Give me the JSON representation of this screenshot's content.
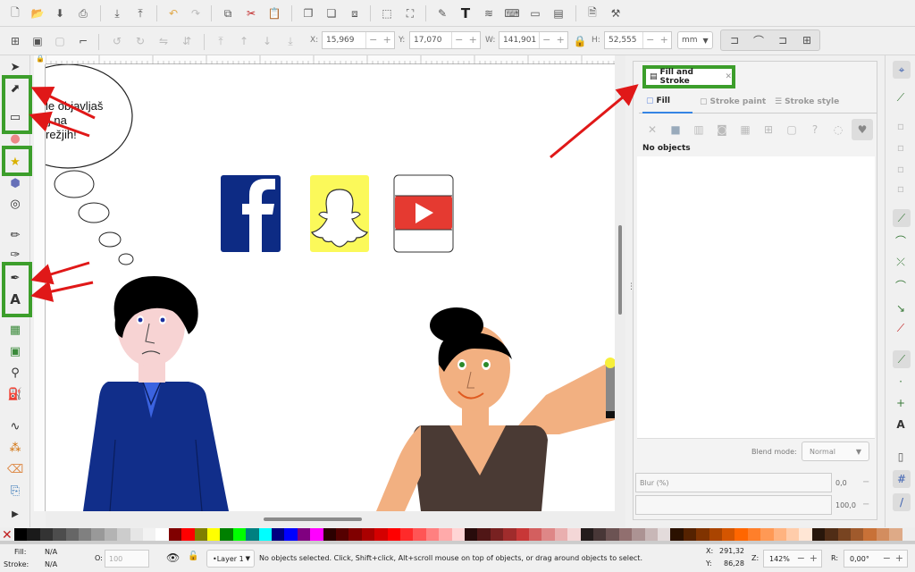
{
  "toolbar_top": {
    "icons": [
      "new-document-icon",
      "open-icon",
      "save-icon",
      "print-icon",
      "import-icon",
      "export-icon",
      "undo-icon",
      "redo-icon",
      "copy-icon",
      "cut-icon",
      "paste-icon",
      "duplicate-icon",
      "clone-icon",
      "unlink-clone-icon",
      "zoom-selection-icon",
      "zoom-drawing-icon",
      "pen-edit-icon",
      "text-icon",
      "layers-icon",
      "xml-editor-icon",
      "align-icon",
      "fill-stroke-icon",
      "document-properties-icon",
      "preferences-icon"
    ]
  },
  "toolbar_select": {
    "x_label": "X:",
    "x_value": "15,969",
    "y_label": "Y:",
    "y_value": "17,070",
    "w_label": "W:",
    "w_value": "141,901",
    "h_label": "H:",
    "h_value": "52,555",
    "units": "mm"
  },
  "speech_bubble": {
    "line1": "e",
    "line2": "le objavljaš",
    "line3": "ij na",
    "line4": "režjih!"
  },
  "panel": {
    "tab_title": "Fill and Stroke",
    "tabs": [
      "Fill",
      "Stroke paint",
      "Stroke style"
    ],
    "no_objects": "No objects",
    "blend_label": "Blend mode:",
    "blend_value": "Normal",
    "blur_label": "Blur (%)",
    "blur_value": "0,0",
    "opacity_value": "100,0"
  },
  "status": {
    "fill_label": "Fill:",
    "fill_value": "N/A",
    "stroke_label": "Stroke:",
    "stroke_value": "N/A",
    "o_label": "O:",
    "o_value": "100",
    "layer": "•Layer 1",
    "message": "No objects selected. Click, Shift+click, Alt+scroll mouse on top of objects, or drag around objects to select.",
    "x_label": "X:",
    "x_value": "291,32",
    "y_label": "Y:",
    "y_value": "86,28",
    "z_label": "Z:",
    "zoom": "142%",
    "r_label": "R:",
    "rotation": "0,00°"
  },
  "colors": {
    "highlight": "#3c9e2b",
    "arrow": "#e01818",
    "facebook": "#0d2b84",
    "snapchat": "#fbf95a",
    "youtube": "#e53a31",
    "shirt": "#112e8a",
    "skin": "#f2b081"
  }
}
